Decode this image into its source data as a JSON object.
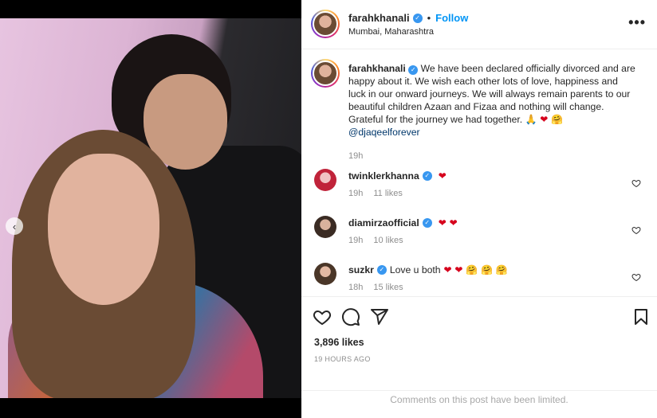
{
  "post": {
    "username": "farahkhanali",
    "follow_label": "Follow",
    "separator": "•",
    "location": "Mumbai, Maharashtra",
    "more_icon": "more-horizontal-icon",
    "carousel": {
      "slide_count": 2,
      "active_slide": 1
    }
  },
  "caption": {
    "username": "farahkhanali",
    "text": "We have been declared officially divorced and are happy about it. We wish each other lots of love, happiness and luck in our onward journeys. We will always remain parents to our beautiful children Azaan and Fizaa and nothing will change. Grateful for the journey we had together. ",
    "emojis": "🙏 ❤ 🤗",
    "mention": "@djaqeelforever",
    "time": "19h"
  },
  "comments": [
    {
      "username": "twinklerkhanna",
      "text": "",
      "emojis": "❤",
      "time": "19h",
      "likes": "11 likes"
    },
    {
      "username": "diamirzaofficial",
      "text": "",
      "emojis": "❤ ❤",
      "time": "19h",
      "likes": "10 likes"
    },
    {
      "username": "suzkr",
      "text": "Love u both",
      "emojis": "❤ ❤ 🤗 🤗 🤗",
      "time": "18h",
      "likes": "15 likes"
    }
  ],
  "footer": {
    "likes": "3,896 likes",
    "time_ago": "19 HOURS AGO",
    "limited_notice": "Comments on this post have been limited."
  },
  "colors": {
    "accent": "#0095f6",
    "verified": "#3897f0",
    "heart_red": "#d6001c",
    "muted": "#8e8e8e"
  }
}
